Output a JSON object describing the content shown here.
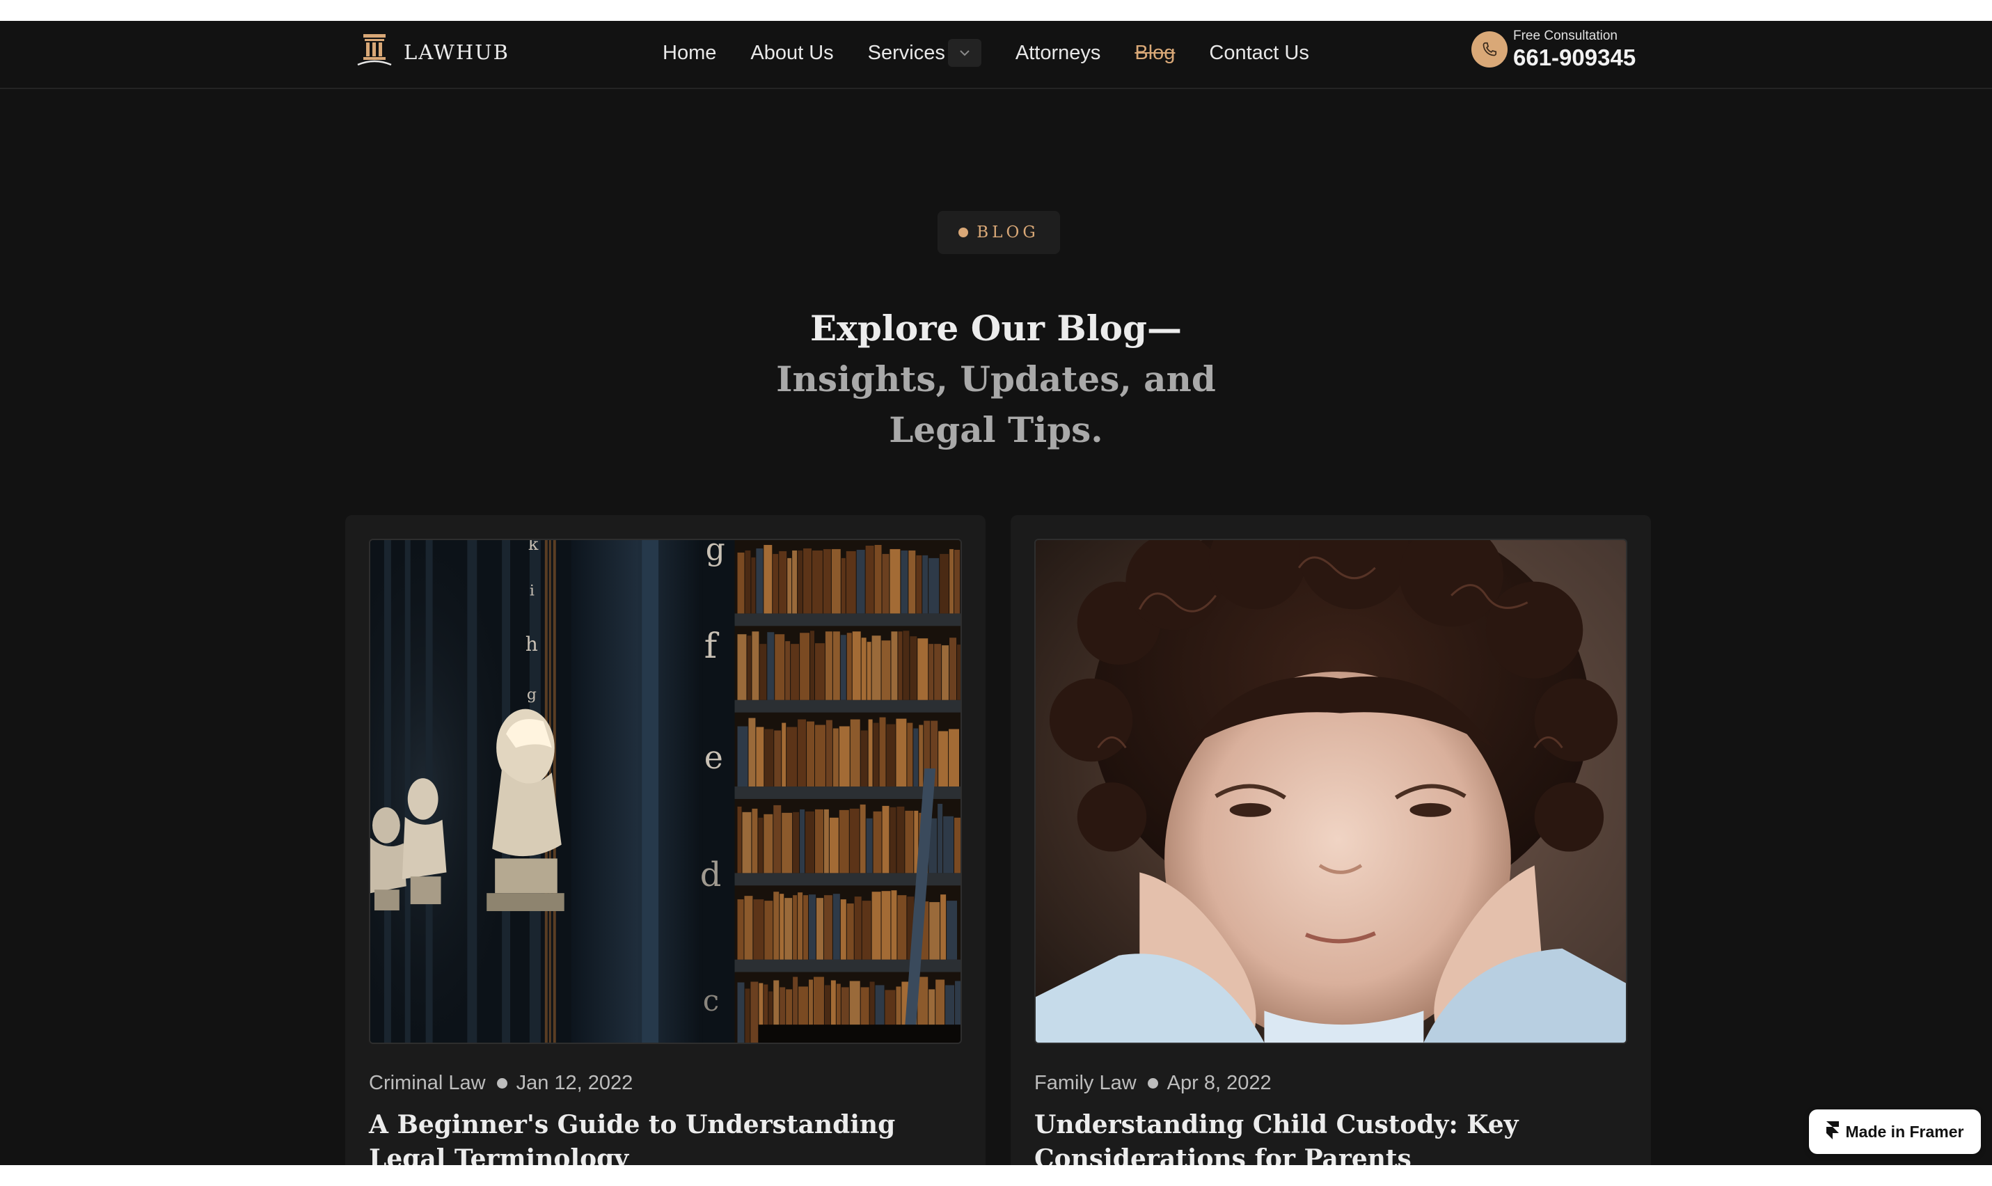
{
  "brand": {
    "name": "LAWHUB",
    "logo_icon": "pillar-icon",
    "accent": "#d9a877"
  },
  "nav": {
    "items": [
      {
        "label": "Home"
      },
      {
        "label": "About Us"
      },
      {
        "label": "Services"
      },
      {
        "label": "Attorneys"
      },
      {
        "label": "Blog"
      },
      {
        "label": "Contact Us"
      }
    ],
    "active": "Blog"
  },
  "consultation": {
    "label": "Free Consultation",
    "phone": "661-909345",
    "icon": "phone-icon"
  },
  "hero": {
    "badge": "BLOG",
    "title_lines": [
      "Explore Our Blog—",
      "Insights, Updates, and",
      "Legal Tips."
    ]
  },
  "posts": [
    {
      "category": "Criminal Law",
      "date": "Jan 12, 2022",
      "title": "A Beginner's Guide to Understanding Legal Terminology",
      "image_letters": [
        "k",
        "i",
        "h",
        "g",
        "g",
        "f",
        "e",
        "d",
        "c"
      ]
    },
    {
      "category": "Family Law",
      "date": "Apr 8, 2022",
      "title": "Understanding Child Custody: Key Considerations for Parents"
    }
  ],
  "framer_badge": {
    "label": "Made in Framer",
    "icon": "framer-icon"
  }
}
